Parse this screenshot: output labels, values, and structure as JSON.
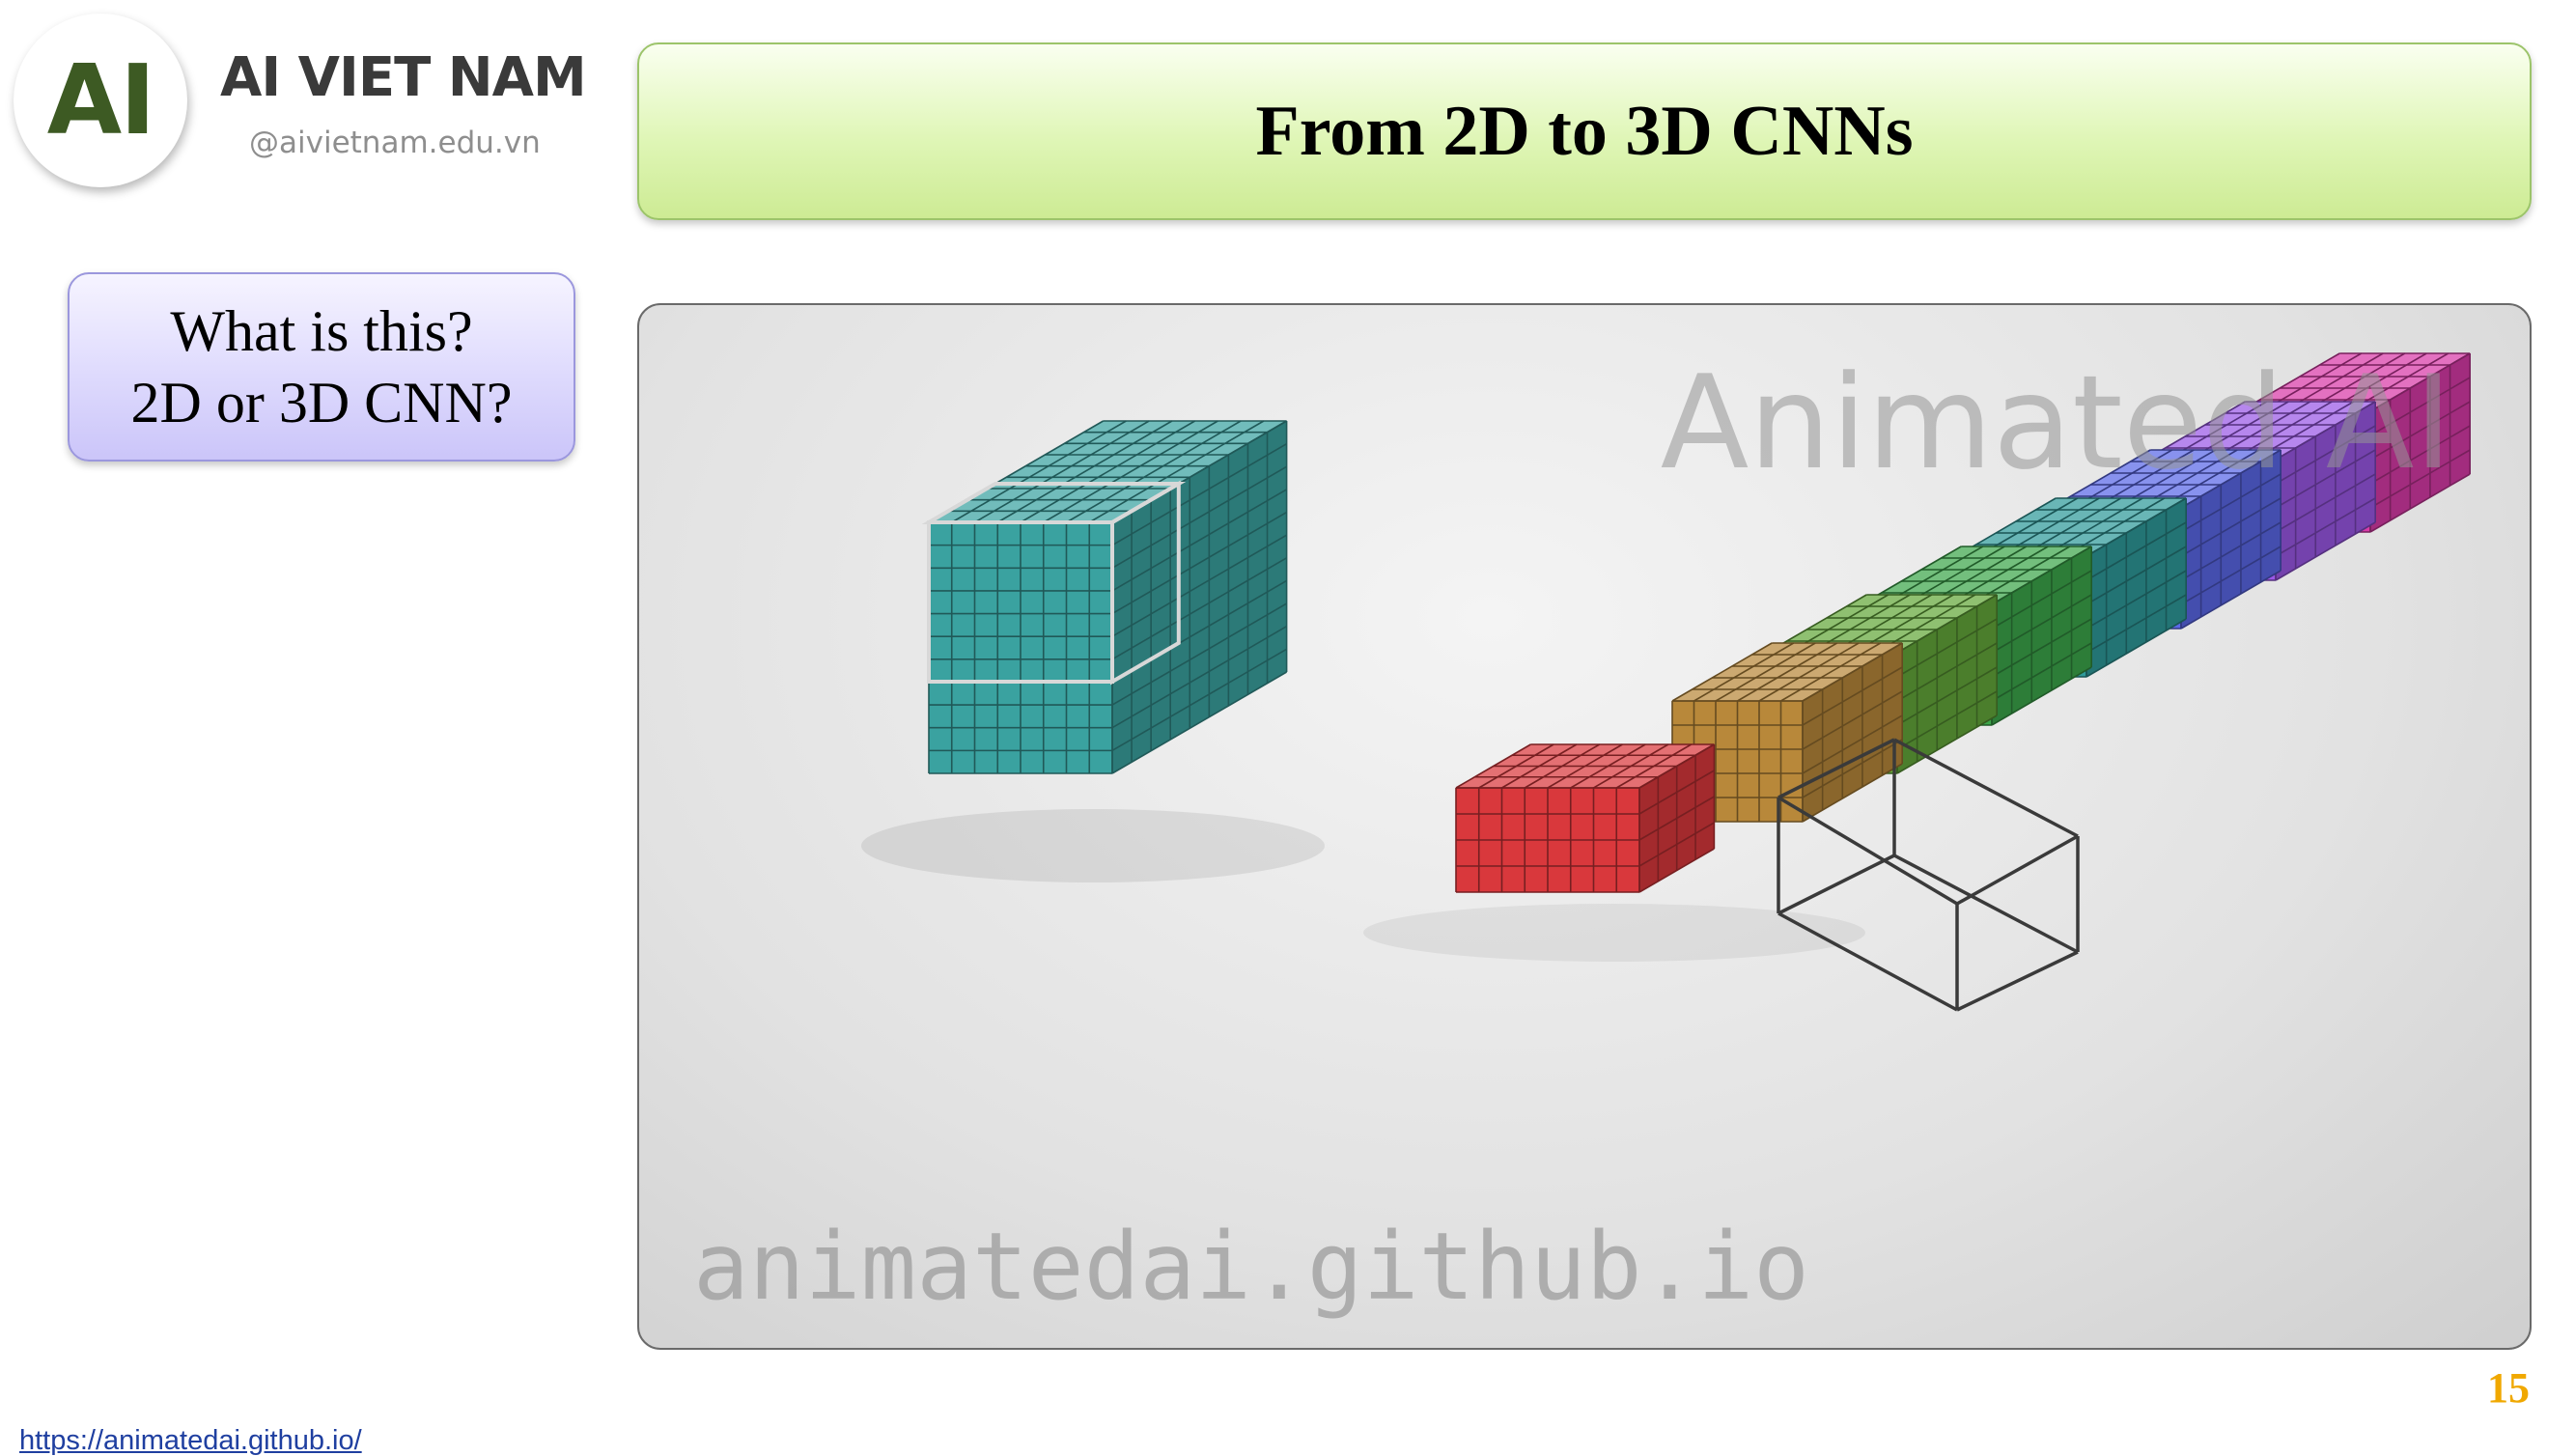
{
  "header": {
    "logo_mark": "AI",
    "brand_name": "AI VIET NAM",
    "brand_site": "@aivietnam.edu.vn"
  },
  "slide": {
    "title": "From 2D to 3D CNNs",
    "question_lines": [
      "What is this?",
      "2D or 3D CNN?"
    ],
    "page_number": "15"
  },
  "figure": {
    "watermark_top": "Animated AI",
    "watermark_bottom": "animatedai.github.io",
    "input_block_color": "#3aa2a0",
    "filter_colors": [
      "#d9383c",
      "#b8883a",
      "#64a83a",
      "#3ca64a",
      "#2f9a9a",
      "#5a68e8",
      "#9a58e6",
      "#d83aa8"
    ]
  },
  "footer": {
    "source_link": "https://animatedai.github.io/"
  }
}
